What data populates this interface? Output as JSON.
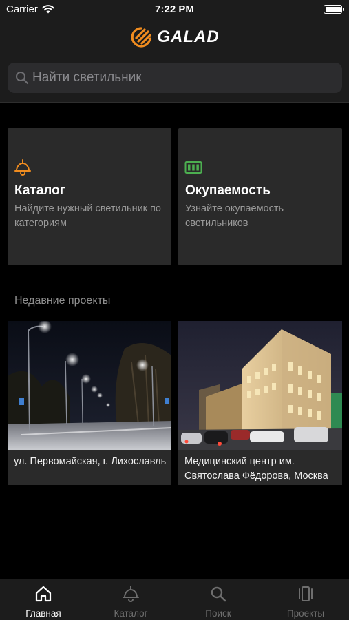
{
  "status_bar": {
    "carrier": "Carrier",
    "time": "7:22 PM",
    "wifi_icon": "wifi-icon",
    "battery_icon": "battery-icon"
  },
  "header": {
    "logo_text": "GALAD",
    "logo_icon": "galad-logo-icon",
    "search": {
      "placeholder": "Найти светильник",
      "icon": "search-icon"
    }
  },
  "cards": [
    {
      "title": "Каталог",
      "description": "Найдите нужный светильник по категориям",
      "icon": "lamp-icon",
      "icon_color": "#f08c1f"
    },
    {
      "title": "Окупаемость",
      "description": "Узнайте окупаемость светильников",
      "icon": "battery-charge-icon",
      "icon_color": "#4caf50"
    }
  ],
  "recent_projects": {
    "title": "Недавние проекты",
    "items": [
      {
        "title": "ул. Первомайская, г. Лихославль",
        "image": "night-street-photo"
      },
      {
        "title": "Медицинский центр им. Святослава Фёдорова, Москва",
        "image": "illuminated-building-photo"
      }
    ]
  },
  "tabbar": {
    "tabs": [
      {
        "label": "Главная",
        "icon": "home-icon",
        "active": true
      },
      {
        "label": "Каталог",
        "icon": "lamp-icon",
        "active": false
      },
      {
        "label": "Поиск",
        "icon": "search-icon",
        "active": false
      },
      {
        "label": "Проекты",
        "icon": "projects-icon",
        "active": false
      }
    ]
  },
  "colors": {
    "accent": "#f08c1f",
    "success": "#4caf50",
    "background": "#000000",
    "surface": "#2a2a2a",
    "bar": "#1c1c1c"
  }
}
